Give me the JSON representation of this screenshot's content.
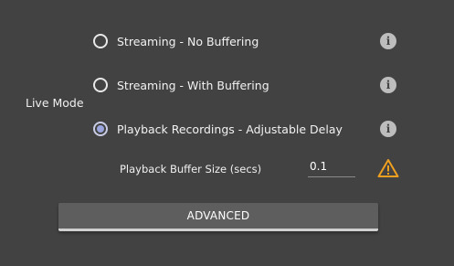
{
  "live_mode": {
    "label": "Live Mode",
    "options": [
      {
        "label": "Streaming - No Buffering",
        "selected": false,
        "info_icon": "info-icon"
      },
      {
        "label": "Streaming - With Buffering",
        "selected": false,
        "info_icon": "info-icon"
      },
      {
        "label": "Playback Recordings - Adjustable Delay",
        "selected": true,
        "info_icon": "info-icon"
      }
    ]
  },
  "buffer": {
    "label": "Playback Buffer Size (secs)",
    "value": "0.1",
    "warning_icon": "warning-triangle-icon"
  },
  "advanced_button": {
    "label": "ADVANCED"
  },
  "colors": {
    "background": "#424242",
    "radio_selected": "#9aa4dd",
    "warning": "#f0a020",
    "info_icon": "#bdbdbd"
  }
}
